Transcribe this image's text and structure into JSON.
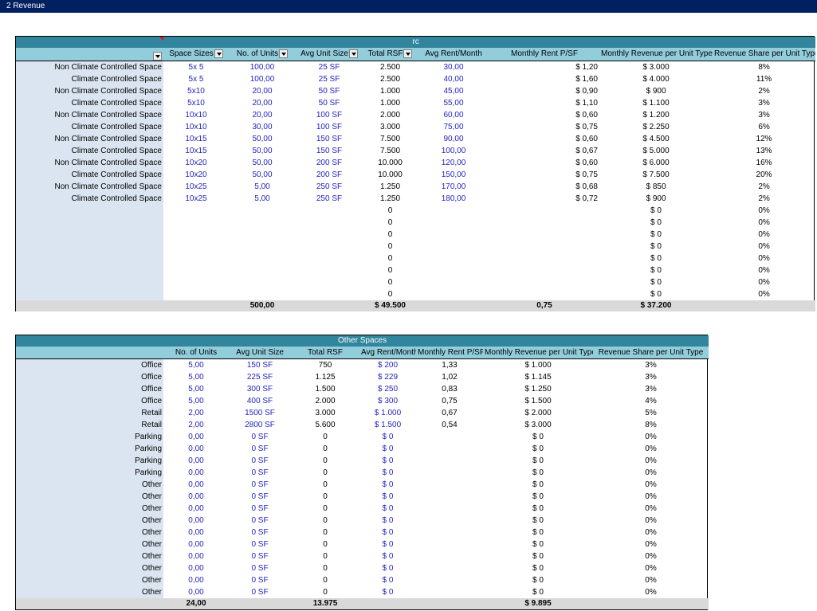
{
  "sheet_title": "2  Revenue",
  "colors": {
    "title_bar": "#002060",
    "band": "#31859c",
    "header": "#92cddc",
    "label_col": "#dbe5f1",
    "total_row": "#d9d9d9",
    "input_text": "#1f1fbf"
  },
  "sc_table": {
    "band_title": "rc",
    "headers": [
      "",
      "Space Sizes",
      "No. of Units",
      "Avg Unit Size",
      "Total RSF",
      "Avg Rent/Month",
      "Monthly Rent P/SF",
      "Monthly Revenue per Unit Type",
      "Revenue Share per Unit Type"
    ],
    "rows": [
      [
        "Non Climate Controlled Space",
        "5x 5",
        "100,00",
        "25 SF",
        "2.500",
        "30,00",
        "$ 1,20",
        "$ 3.000",
        "8%"
      ],
      [
        "Climate Controlled Space",
        "5x 5",
        "100,00",
        "25 SF",
        "2.500",
        "40,00",
        "$ 1,60",
        "$ 4.000",
        "11%"
      ],
      [
        "Non Climate Controlled Space",
        "5x10",
        "20,00",
        "50 SF",
        "1.000",
        "45,00",
        "$ 0,90",
        "$ 900",
        "2%"
      ],
      [
        "Climate Controlled Space",
        "5x10",
        "20,00",
        "50 SF",
        "1.000",
        "55,00",
        "$ 1,10",
        "$ 1.100",
        "3%"
      ],
      [
        "Non Climate Controlled Space",
        "10x10",
        "20,00",
        "100 SF",
        "2.000",
        "60,00",
        "$ 0,60",
        "$ 1.200",
        "3%"
      ],
      [
        "Climate Controlled Space",
        "10x10",
        "30,00",
        "100 SF",
        "3.000",
        "75,00",
        "$ 0,75",
        "$ 2.250",
        "6%"
      ],
      [
        "Non Climate Controlled Space",
        "10x15",
        "50,00",
        "150 SF",
        "7.500",
        "90,00",
        "$ 0,60",
        "$ 4.500",
        "12%"
      ],
      [
        "Climate Controlled Space",
        "10x15",
        "50,00",
        "150 SF",
        "7.500",
        "100,00",
        "$ 0,67",
        "$ 5.000",
        "13%"
      ],
      [
        "Non Climate Controlled Space",
        "10x20",
        "50,00",
        "200 SF",
        "10.000",
        "120,00",
        "$ 0,60",
        "$ 6.000",
        "16%"
      ],
      [
        "Climate Controlled Space",
        "10x20",
        "50,00",
        "200 SF",
        "10.000",
        "150,00",
        "$ 0,75",
        "$ 7.500",
        "20%"
      ],
      [
        "Non Climate Controlled Space",
        "10x25",
        "5,00",
        "250 SF",
        "1.250",
        "170,00",
        "$ 0,68",
        "$ 850",
        "2%"
      ],
      [
        "Climate Controlled Space",
        "10x25",
        "5,00",
        "250 SF",
        "1.250",
        "180,00",
        "$ 0,72",
        "$ 900",
        "2%"
      ],
      [
        "",
        "",
        "",
        "",
        "0",
        "",
        "",
        "$ 0",
        "0%"
      ],
      [
        "",
        "",
        "",
        "",
        "0",
        "",
        "",
        "$ 0",
        "0%"
      ],
      [
        "",
        "",
        "",
        "",
        "0",
        "",
        "",
        "$ 0",
        "0%"
      ],
      [
        "",
        "",
        "",
        "",
        "0",
        "",
        "",
        "$ 0",
        "0%"
      ],
      [
        "",
        "",
        "",
        "",
        "0",
        "",
        "",
        "$ 0",
        "0%"
      ],
      [
        "",
        "",
        "",
        "",
        "0",
        "",
        "",
        "$ 0",
        "0%"
      ],
      [
        "",
        "",
        "",
        "",
        "0",
        "",
        "",
        "$ 0",
        "0%"
      ],
      [
        "",
        "",
        "",
        "",
        "0",
        "",
        "",
        "$ 0",
        "0%"
      ]
    ],
    "totals": [
      "",
      "",
      "500,00",
      "",
      "$ 49.500",
      "",
      "0,75",
      "$ 37.200",
      ""
    ]
  },
  "other_table": {
    "band_title": "Other  Spaces",
    "headers": [
      "",
      "No. of Units",
      "Avg Unit Size",
      "Total RSF",
      "Avg Rent/Month",
      "Monthly Rent P/SF",
      "Monthly Revenue per Unit Type",
      "Revenue Share per Unit Type"
    ],
    "rows": [
      [
        "Office",
        "5,00",
        "150 SF",
        "750",
        "$ 200",
        "1,33",
        "$ 1.000",
        "3%"
      ],
      [
        "Office",
        "5,00",
        "225 SF",
        "1.125",
        "$ 229",
        "1,02",
        "$ 1.145",
        "3%"
      ],
      [
        "Office",
        "5,00",
        "300 SF",
        "1.500",
        "$ 250",
        "0,83",
        "$ 1.250",
        "3%"
      ],
      [
        "Office",
        "5,00",
        "400 SF",
        "2.000",
        "$ 300",
        "0,75",
        "$ 1.500",
        "4%"
      ],
      [
        "Retail",
        "2,00",
        "1500 SF",
        "3.000",
        "$ 1.000",
        "0,67",
        "$ 2.000",
        "5%"
      ],
      [
        "Retail",
        "2,00",
        "2800 SF",
        "5.600",
        "$ 1.500",
        "0,54",
        "$ 3.000",
        "8%"
      ],
      [
        "Parking",
        "0,00",
        "0 SF",
        "0",
        "$ 0",
        "",
        "$ 0",
        "0%"
      ],
      [
        "Parking",
        "0,00",
        "0 SF",
        "0",
        "$ 0",
        "",
        "$ 0",
        "0%"
      ],
      [
        "Parking",
        "0,00",
        "0 SF",
        "0",
        "$ 0",
        "",
        "$ 0",
        "0%"
      ],
      [
        "Parking",
        "0,00",
        "0 SF",
        "0",
        "$ 0",
        "",
        "$ 0",
        "0%"
      ],
      [
        "Other",
        "0,00",
        "0 SF",
        "0",
        "$ 0",
        "",
        "$ 0",
        "0%"
      ],
      [
        "Other",
        "0,00",
        "0 SF",
        "0",
        "$ 0",
        "",
        "$ 0",
        "0%"
      ],
      [
        "Other",
        "0,00",
        "0 SF",
        "0",
        "$ 0",
        "",
        "$ 0",
        "0%"
      ],
      [
        "Other",
        "0,00",
        "0 SF",
        "0",
        "$ 0",
        "",
        "$ 0",
        "0%"
      ],
      [
        "Other",
        "0,00",
        "0 SF",
        "0",
        "$ 0",
        "",
        "$ 0",
        "0%"
      ],
      [
        "Other",
        "0,00",
        "0 SF",
        "0",
        "$ 0",
        "",
        "$ 0",
        "0%"
      ],
      [
        "Other",
        "0,00",
        "0 SF",
        "0",
        "$ 0",
        "",
        "$ 0",
        "0%"
      ],
      [
        "Other",
        "0,00",
        "0 SF",
        "0",
        "$ 0",
        "",
        "$ 0",
        "0%"
      ],
      [
        "Other",
        "0,00",
        "0 SF",
        "0",
        "$ 0",
        "",
        "$ 0",
        "0%"
      ],
      [
        "Other",
        "0,00",
        "0 SF",
        "0",
        "$ 0",
        "",
        "$ 0",
        "0%"
      ]
    ],
    "totals": [
      "",
      "24,00",
      "",
      "13.975",
      "",
      "",
      "$ 9.895",
      ""
    ]
  }
}
